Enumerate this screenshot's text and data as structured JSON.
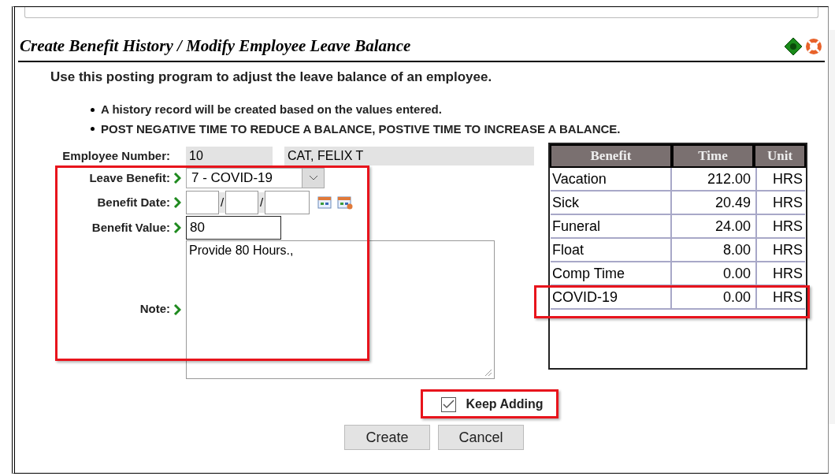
{
  "title": "Create Benefit History / Modify Employee Leave Balance",
  "intro": "Use this posting program to adjust the leave balance of an employee.",
  "bullets": [
    "A history record will be created based on the values entered.",
    "POST NEGATIVE TIME TO REDUCE A BALANCE, POSTIVE TIME TO INCREASE A BALANCE."
  ],
  "employee_number": {
    "label": "Employee Number:",
    "number": "10",
    "name": "CAT, FELIX T"
  },
  "leave_benefit": {
    "label": "Leave Benefit:",
    "value": "7 - COVID-19"
  },
  "benefit_date": {
    "label": "Benefit Date:",
    "separators": [
      "/",
      "/"
    ]
  },
  "benefit_value": {
    "label": "Benefit Value:",
    "value": "80"
  },
  "note": {
    "label": "Note:",
    "value": "Provide 80 Hours.,"
  },
  "table": {
    "columns": [
      "Benefit",
      "Time",
      "Unit"
    ],
    "rows": [
      [
        "Vacation",
        "212.00",
        "HRS"
      ],
      [
        "Sick",
        "20.49",
        "HRS"
      ],
      [
        "Funeral",
        "24.00",
        "HRS"
      ],
      [
        "Float",
        "8.00",
        "HRS"
      ],
      [
        "Comp Time",
        "0.00",
        "HRS"
      ],
      [
        "COVID-19",
        "0.00",
        "HRS"
      ]
    ]
  },
  "keep_adding": {
    "label": "Keep Adding",
    "checked": true
  },
  "buttons": [
    "Create",
    "Cancel"
  ]
}
